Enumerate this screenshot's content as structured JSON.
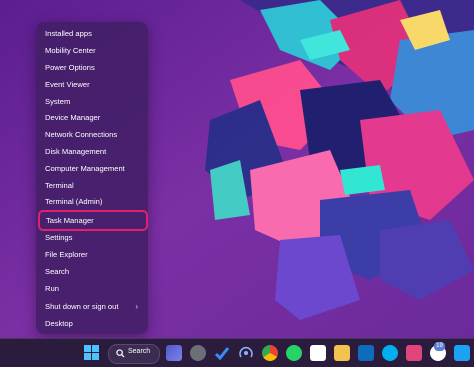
{
  "menu": {
    "items": [
      {
        "label": "Installed apps"
      },
      {
        "label": "Mobility Center"
      },
      {
        "label": "Power Options"
      },
      {
        "label": "Event Viewer"
      },
      {
        "label": "System"
      },
      {
        "label": "Device Manager"
      },
      {
        "label": "Network Connections"
      },
      {
        "label": "Disk Management"
      },
      {
        "label": "Computer Management"
      },
      {
        "label": "Terminal"
      },
      {
        "label": "Terminal (Admin)"
      },
      {
        "label": "Task Manager"
      },
      {
        "label": "Settings"
      },
      {
        "label": "File Explorer"
      },
      {
        "label": "Search"
      },
      {
        "label": "Run"
      },
      {
        "label": "Shut down or sign out"
      },
      {
        "label": "Desktop"
      }
    ],
    "highlight_color": "#e3206b"
  },
  "taskbar": {
    "search_label": "Search",
    "badge_count": "19",
    "icons": [
      "windows-start-icon",
      "search-icon",
      "teams-icon",
      "settings-gear-icon",
      "todo-check-icon",
      "podcast-icon",
      "chrome-icon",
      "whatsapp-icon",
      "slack-icon",
      "file-explorer-icon",
      "outlook-icon",
      "skype-icon",
      "camera-icon",
      "music-icon",
      "twitter-icon",
      "store-icon"
    ]
  }
}
